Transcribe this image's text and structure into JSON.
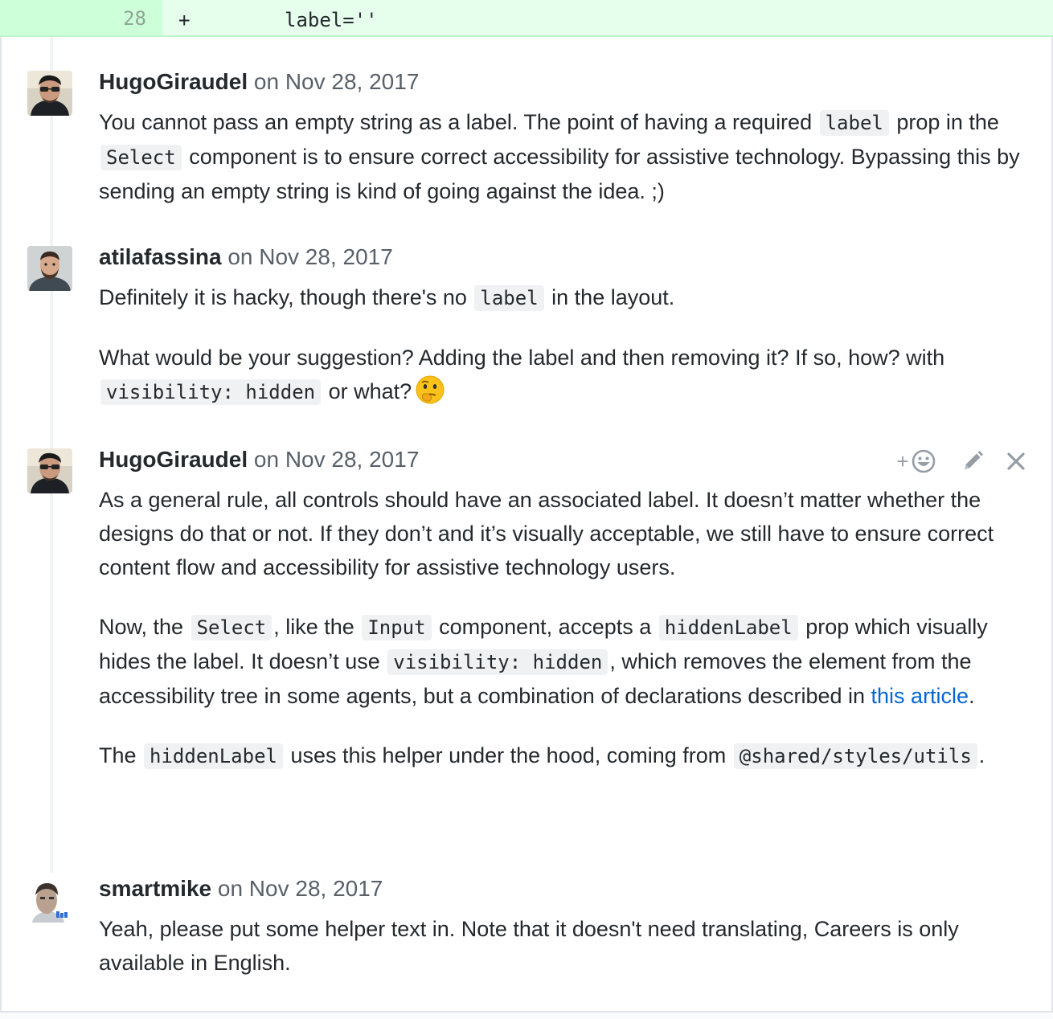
{
  "diff": {
    "line_number": "28",
    "marker": "+",
    "code": "label=''"
  },
  "comments": [
    {
      "author": "HugoGiraudel",
      "date": "on Nov 28, 2017",
      "avatar": "avatar-hugogiraudel",
      "paragraphs": [
        [
          {
            "t": "text",
            "v": "You cannot pass an empty string as a label. The point of having a required "
          },
          {
            "t": "code",
            "v": "label"
          },
          {
            "t": "text",
            "v": " prop in the "
          },
          {
            "t": "code",
            "v": "Select"
          },
          {
            "t": "text",
            "v": " component is to ensure correct accessibility for assistive technology. Bypassing this by sending an empty string is kind of going against the idea. ;)"
          }
        ]
      ]
    },
    {
      "author": "atilafassina",
      "date": "on Nov 28, 2017",
      "avatar": "avatar-atilafassina",
      "paragraphs": [
        [
          {
            "t": "text",
            "v": "Definitely it is hacky, though there's no "
          },
          {
            "t": "code",
            "v": "label"
          },
          {
            "t": "text",
            "v": " in the layout."
          }
        ],
        [
          {
            "t": "text",
            "v": "What would be your suggestion? Adding the label and then removing it? If so, how? with "
          },
          {
            "t": "code",
            "v": "visibility: hidden"
          },
          {
            "t": "text",
            "v": " or what?"
          },
          {
            "t": "emoji",
            "v": "thinking-face-emoji"
          }
        ]
      ]
    },
    {
      "author": "HugoGiraudel",
      "date": "on Nov 28, 2017",
      "avatar": "avatar-hugogiraudel",
      "paragraphs": [
        [
          {
            "t": "text",
            "v": "As a general rule, all controls should have an associated label. It doesn’t matter whether the designs do that or not. If they don’t and it’s visually acceptable, we still have to ensure correct content flow and accessibility for assistive technology users."
          }
        ],
        [
          {
            "t": "text",
            "v": "Now, the "
          },
          {
            "t": "code",
            "v": "Select"
          },
          {
            "t": "text",
            "v": ", like the "
          },
          {
            "t": "code",
            "v": "Input"
          },
          {
            "t": "text",
            "v": " component, accepts a "
          },
          {
            "t": "code",
            "v": "hiddenLabel"
          },
          {
            "t": "text",
            "v": " prop which visually hides the label. It doesn’t use "
          },
          {
            "t": "code",
            "v": "visibility: hidden"
          },
          {
            "t": "text",
            "v": ", which removes the element from the accessibility tree in some agents, but a combination of declarations described in "
          },
          {
            "t": "link",
            "v": "this article"
          },
          {
            "t": "text",
            "v": "."
          }
        ],
        [
          {
            "t": "text",
            "v": "The "
          },
          {
            "t": "code",
            "v": "hiddenLabel"
          },
          {
            "t": "text",
            "v": " uses this helper under the hood, coming from "
          },
          {
            "t": "code",
            "v": "@shared/styles/utils"
          },
          {
            "t": "text",
            "v": "."
          }
        ]
      ],
      "actions": {
        "add_reaction": "+",
        "add_reaction_icon": "smiley-icon",
        "edit_icon": "pencil-icon",
        "delete_icon": "close-icon"
      }
    },
    {
      "author": "smartmike",
      "date": "on Nov 28, 2017",
      "avatar": "avatar-smartmike",
      "paragraphs": [
        [
          {
            "t": "text",
            "v": "Yeah, please put some helper text in. Note that it doesn't need translating, Careers is only available in English."
          }
        ]
      ]
    }
  ],
  "colors": {
    "diff_added_bg": "#e6ffed",
    "diff_number_bg": "#cdffd8",
    "link": "#0366d6",
    "code_bg": "#f0f1f3",
    "meta_text": "#586069"
  }
}
